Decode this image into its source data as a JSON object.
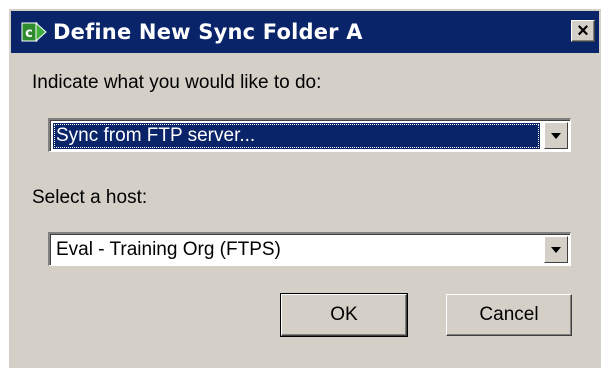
{
  "window": {
    "title": "Define New Sync Folder A",
    "close_label": "×",
    "icon": "app-sync-icon",
    "titlebar_color": "#0a246a"
  },
  "action": {
    "label": "Indicate what you would like to do:",
    "selected_value": "Sync from FTP server..."
  },
  "host": {
    "label": "Select a host:",
    "selected_value": "Eval - Training Org (FTPS)"
  },
  "buttons": {
    "ok_label": "OK",
    "cancel_label": "Cancel"
  }
}
